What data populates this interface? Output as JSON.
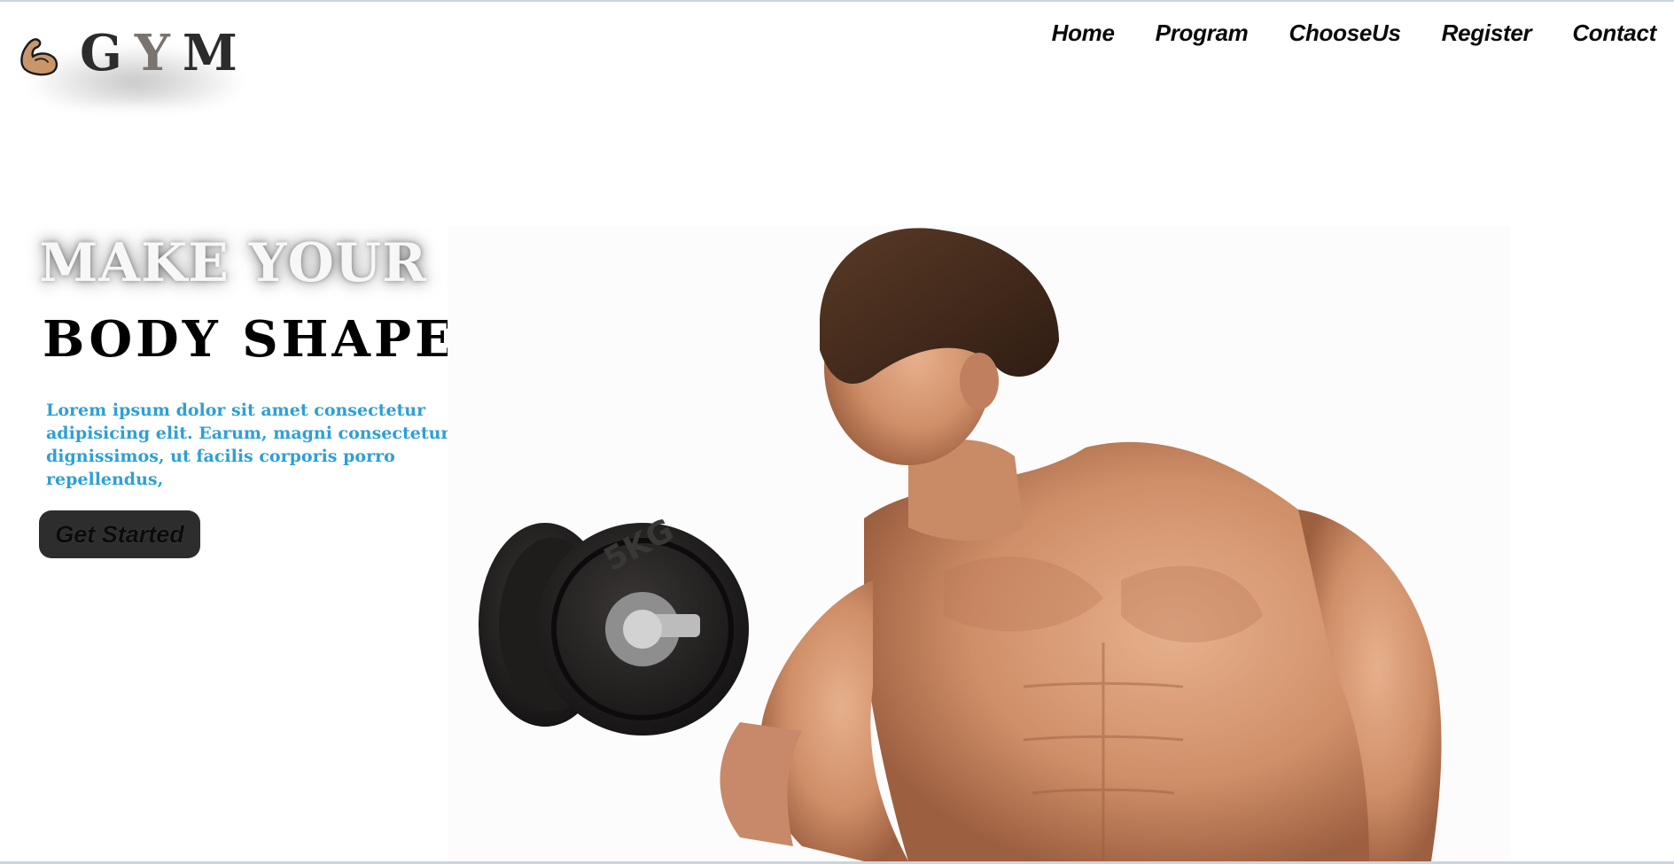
{
  "brand": {
    "letters": [
      "G",
      "Y",
      "M"
    ],
    "icon": "flexed-bicep-icon"
  },
  "nav": {
    "items": [
      {
        "label": "Home"
      },
      {
        "label": "Program"
      },
      {
        "label": "ChooseUs"
      },
      {
        "label": "Register"
      },
      {
        "label": "Contact"
      }
    ]
  },
  "hero": {
    "title_line1": "MAKE YOUR",
    "title_line2": "BODY SHAPE",
    "description": "Lorem ipsum dolor sit amet consectetur adipisicing elit. Earum, magni consectetur dignissimos, ut facilis corporis porro repellendus,",
    "cta_label": "Get Started",
    "image_subject": "muscular-man-with-dumbbell",
    "dumbbell_marking": "5KG"
  },
  "colors": {
    "accent": "#2e9fd6",
    "button_bg": "#2d2d2d",
    "skin": "#d8a07a"
  }
}
